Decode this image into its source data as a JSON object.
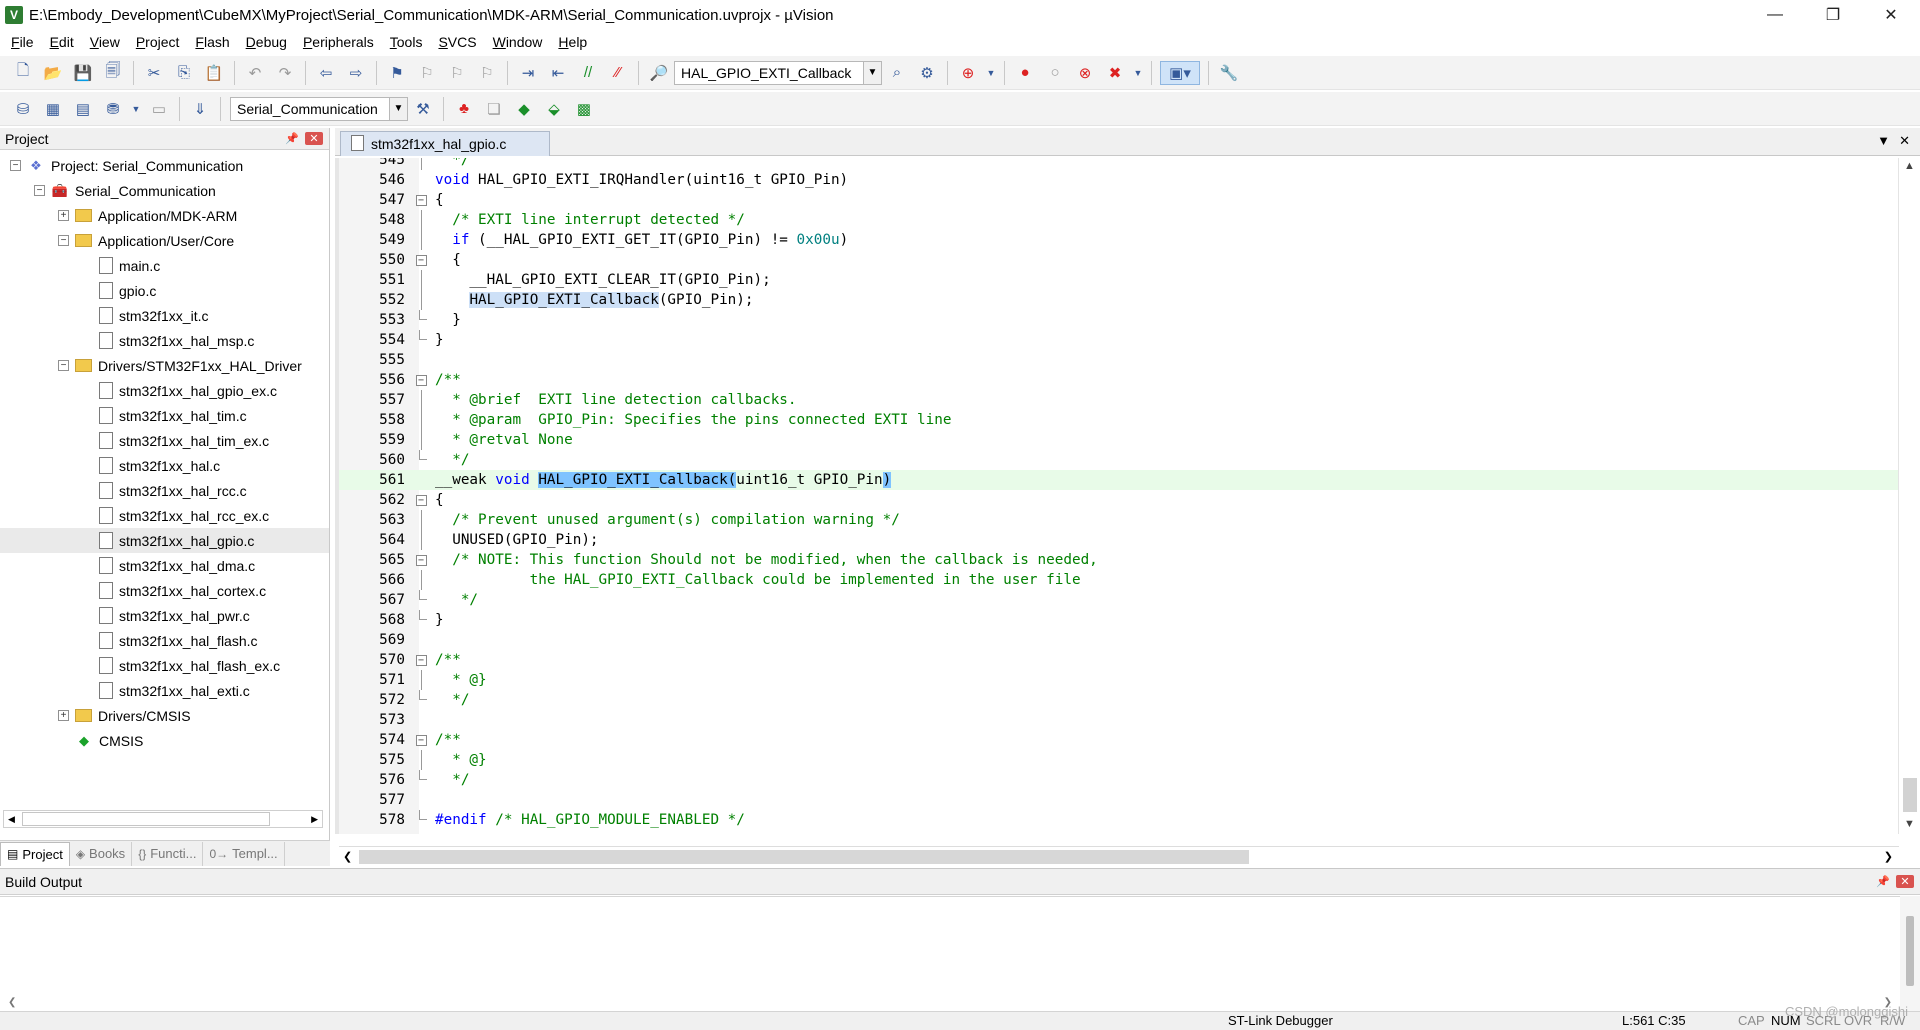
{
  "window": {
    "title": "E:\\Embody_Development\\CubeMX\\MyProject\\Serial_Communication\\MDK-ARM\\Serial_Communication.uvprojx - µVision",
    "minimize": "—",
    "restore": "❐",
    "close": "✕"
  },
  "menu": [
    "File",
    "Edit",
    "View",
    "Project",
    "Flash",
    "Debug",
    "Peripherals",
    "Tools",
    "SVCS",
    "Window",
    "Help"
  ],
  "toolbar": {
    "function_combo": "HAL_GPIO_EXTI_Callback",
    "target_combo": "Serial_Communication"
  },
  "project_panel": {
    "title": "Project",
    "tree": [
      {
        "label": "Project: Serial_Communication",
        "depth": 0,
        "icon": "project",
        "toggle": "⊟"
      },
      {
        "label": "Serial_Communication",
        "depth": 1,
        "icon": "target",
        "toggle": "⊟"
      },
      {
        "label": "Application/MDK-ARM",
        "depth": 2,
        "icon": "folder",
        "toggle": "+"
      },
      {
        "label": "Application/User/Core",
        "depth": 2,
        "icon": "folder",
        "toggle": "−"
      },
      {
        "label": "main.c",
        "depth": 3,
        "icon": "file"
      },
      {
        "label": "gpio.c",
        "depth": 3,
        "icon": "file"
      },
      {
        "label": "stm32f1xx_it.c",
        "depth": 3,
        "icon": "file"
      },
      {
        "label": "stm32f1xx_hal_msp.c",
        "depth": 3,
        "icon": "file"
      },
      {
        "label": "Drivers/STM32F1xx_HAL_Driver",
        "depth": 2,
        "icon": "folder",
        "toggle": "−"
      },
      {
        "label": "stm32f1xx_hal_gpio_ex.c",
        "depth": 3,
        "icon": "file"
      },
      {
        "label": "stm32f1xx_hal_tim.c",
        "depth": 3,
        "icon": "file"
      },
      {
        "label": "stm32f1xx_hal_tim_ex.c",
        "depth": 3,
        "icon": "file"
      },
      {
        "label": "stm32f1xx_hal.c",
        "depth": 3,
        "icon": "file"
      },
      {
        "label": "stm32f1xx_hal_rcc.c",
        "depth": 3,
        "icon": "file"
      },
      {
        "label": "stm32f1xx_hal_rcc_ex.c",
        "depth": 3,
        "icon": "file"
      },
      {
        "label": "stm32f1xx_hal_gpio.c",
        "depth": 3,
        "icon": "file",
        "selected": true
      },
      {
        "label": "stm32f1xx_hal_dma.c",
        "depth": 3,
        "icon": "file"
      },
      {
        "label": "stm32f1xx_hal_cortex.c",
        "depth": 3,
        "icon": "file"
      },
      {
        "label": "stm32f1xx_hal_pwr.c",
        "depth": 3,
        "icon": "file"
      },
      {
        "label": "stm32f1xx_hal_flash.c",
        "depth": 3,
        "icon": "file"
      },
      {
        "label": "stm32f1xx_hal_flash_ex.c",
        "depth": 3,
        "icon": "file"
      },
      {
        "label": "stm32f1xx_hal_exti.c",
        "depth": 3,
        "icon": "file"
      },
      {
        "label": "Drivers/CMSIS",
        "depth": 2,
        "icon": "folder",
        "toggle": "+"
      },
      {
        "label": "CMSIS",
        "depth": 2,
        "icon": "cmsis"
      }
    ],
    "bottom_tabs": [
      {
        "label": "Project",
        "icon": "▤",
        "active": true
      },
      {
        "label": "Books",
        "icon": "◈",
        "active": false
      },
      {
        "label": "Functi...",
        "icon": "{}",
        "active": false
      },
      {
        "label": "Templ...",
        "icon": "0→",
        "active": false
      }
    ]
  },
  "editor": {
    "tab_label": "stm32f1xx_hal_gpio.c",
    "current_line": 561,
    "lines": [
      {
        "n": "545",
        "fold": "line",
        "tokens": [
          [
            "cm",
            "  */"
          ]
        ]
      },
      {
        "n": "546",
        "fold": "",
        "tokens": [
          [
            "kw",
            "void"
          ],
          [
            "",
            " HAL_GPIO_EXTI_IRQHandler(uint16_t GPIO_Pin)"
          ]
        ]
      },
      {
        "n": "547",
        "fold": "box",
        "tokens": [
          [
            "",
            "{"
          ]
        ]
      },
      {
        "n": "548",
        "fold": "line",
        "tokens": [
          [
            "",
            "  "
          ],
          [
            "cm",
            "/* EXTI line interrupt detected */"
          ]
        ]
      },
      {
        "n": "549",
        "fold": "line",
        "tokens": [
          [
            "",
            "  "
          ],
          [
            "kw",
            "if"
          ],
          [
            "",
            " (__HAL_GPIO_EXTI_GET_IT(GPIO_Pin) != "
          ],
          [
            "num",
            "0x00u"
          ],
          [
            "",
            ")"
          ]
        ]
      },
      {
        "n": "550",
        "fold": "box",
        "tokens": [
          [
            "",
            "  {"
          ]
        ]
      },
      {
        "n": "551",
        "fold": "line",
        "tokens": [
          [
            "",
            "    __HAL_GPIO_EXTI_CLEAR_IT(GPIO_Pin);"
          ]
        ]
      },
      {
        "n": "552",
        "fold": "line",
        "tokens": [
          [
            "",
            "    "
          ],
          [
            "sel",
            "HAL_GPIO_EXTI_Callback"
          ],
          [
            "",
            "(GPIO_Pin);"
          ]
        ]
      },
      {
        "n": "553",
        "fold": "end",
        "tokens": [
          [
            "",
            "  }"
          ]
        ]
      },
      {
        "n": "554",
        "fold": "end",
        "tokens": [
          [
            "",
            "}"
          ]
        ]
      },
      {
        "n": "555",
        "fold": "",
        "tokens": [
          [
            "",
            ""
          ]
        ]
      },
      {
        "n": "556",
        "fold": "box",
        "tokens": [
          [
            "cm",
            "/**"
          ]
        ]
      },
      {
        "n": "557",
        "fold": "line",
        "tokens": [
          [
            "cm",
            "  * @brief  EXTI line detection callbacks."
          ]
        ]
      },
      {
        "n": "558",
        "fold": "line",
        "tokens": [
          [
            "cm",
            "  * @param  GPIO_Pin: Specifies the pins connected EXTI line"
          ]
        ]
      },
      {
        "n": "559",
        "fold": "line",
        "tokens": [
          [
            "cm",
            "  * @retval None"
          ]
        ]
      },
      {
        "n": "560",
        "fold": "end",
        "tokens": [
          [
            "cm",
            "  */"
          ]
        ]
      },
      {
        "n": "561",
        "fold": "",
        "tokens": [
          [
            "",
            "__weak "
          ],
          [
            "kw",
            "void"
          ],
          [
            "",
            " "
          ],
          [
            "selhl",
            "HAL_GPIO_EXTI_Callback("
          ],
          [
            "",
            "uint16_t GPIO_Pin"
          ],
          [
            "selhl",
            ")"
          ]
        ]
      },
      {
        "n": "562",
        "fold": "box",
        "tokens": [
          [
            "",
            "{"
          ]
        ]
      },
      {
        "n": "563",
        "fold": "line",
        "tokens": [
          [
            "",
            "  "
          ],
          [
            "cm",
            "/* Prevent unused argument(s) compilation warning */"
          ]
        ]
      },
      {
        "n": "564",
        "fold": "line",
        "tokens": [
          [
            "",
            "  UNUSED(GPIO_Pin);"
          ]
        ]
      },
      {
        "n": "565",
        "fold": "box",
        "tokens": [
          [
            "",
            "  "
          ],
          [
            "cm",
            "/* NOTE: This function Should not be modified, when the callback is needed,"
          ]
        ]
      },
      {
        "n": "566",
        "fold": "line",
        "tokens": [
          [
            "cm",
            "           the HAL_GPIO_EXTI_Callback could be implemented in the user file"
          ]
        ]
      },
      {
        "n": "567",
        "fold": "end",
        "tokens": [
          [
            "cm",
            "   */"
          ]
        ]
      },
      {
        "n": "568",
        "fold": "end",
        "tokens": [
          [
            "",
            "}"
          ]
        ]
      },
      {
        "n": "569",
        "fold": "",
        "tokens": [
          [
            "",
            ""
          ]
        ]
      },
      {
        "n": "570",
        "fold": "box",
        "tokens": [
          [
            "cm",
            "/**"
          ]
        ]
      },
      {
        "n": "571",
        "fold": "line",
        "tokens": [
          [
            "cm",
            "  * @}"
          ]
        ]
      },
      {
        "n": "572",
        "fold": "end",
        "tokens": [
          [
            "cm",
            "  */"
          ]
        ]
      },
      {
        "n": "573",
        "fold": "",
        "tokens": [
          [
            "",
            ""
          ]
        ]
      },
      {
        "n": "574",
        "fold": "box",
        "tokens": [
          [
            "cm",
            "/**"
          ]
        ]
      },
      {
        "n": "575",
        "fold": "line",
        "tokens": [
          [
            "cm",
            "  * @}"
          ]
        ]
      },
      {
        "n": "576",
        "fold": "end",
        "tokens": [
          [
            "cm",
            "  */"
          ]
        ]
      },
      {
        "n": "577",
        "fold": "",
        "tokens": [
          [
            "",
            ""
          ]
        ]
      },
      {
        "n": "578",
        "fold": "endl",
        "tokens": [
          [
            "kw",
            "#endif"
          ],
          [
            "",
            " "
          ],
          [
            "cm",
            "/* HAL_GPIO_MODULE_ENABLED */"
          ]
        ]
      }
    ]
  },
  "build_output": {
    "title": "Build Output"
  },
  "status": {
    "debugger": "ST-Link Debugger",
    "position": "L:561 C:35",
    "caps": "CAP",
    "num": "NUM",
    "scrl": "SCRL",
    "ovr": "OVR",
    "rw": "R/W"
  },
  "watermark": "CSDN @molonggishi",
  "colors": {
    "keyword": "#0000ff",
    "comment": "#008000",
    "number": "#008080",
    "current_line": "#e8fbe8",
    "selection": "#7fc3ff"
  }
}
